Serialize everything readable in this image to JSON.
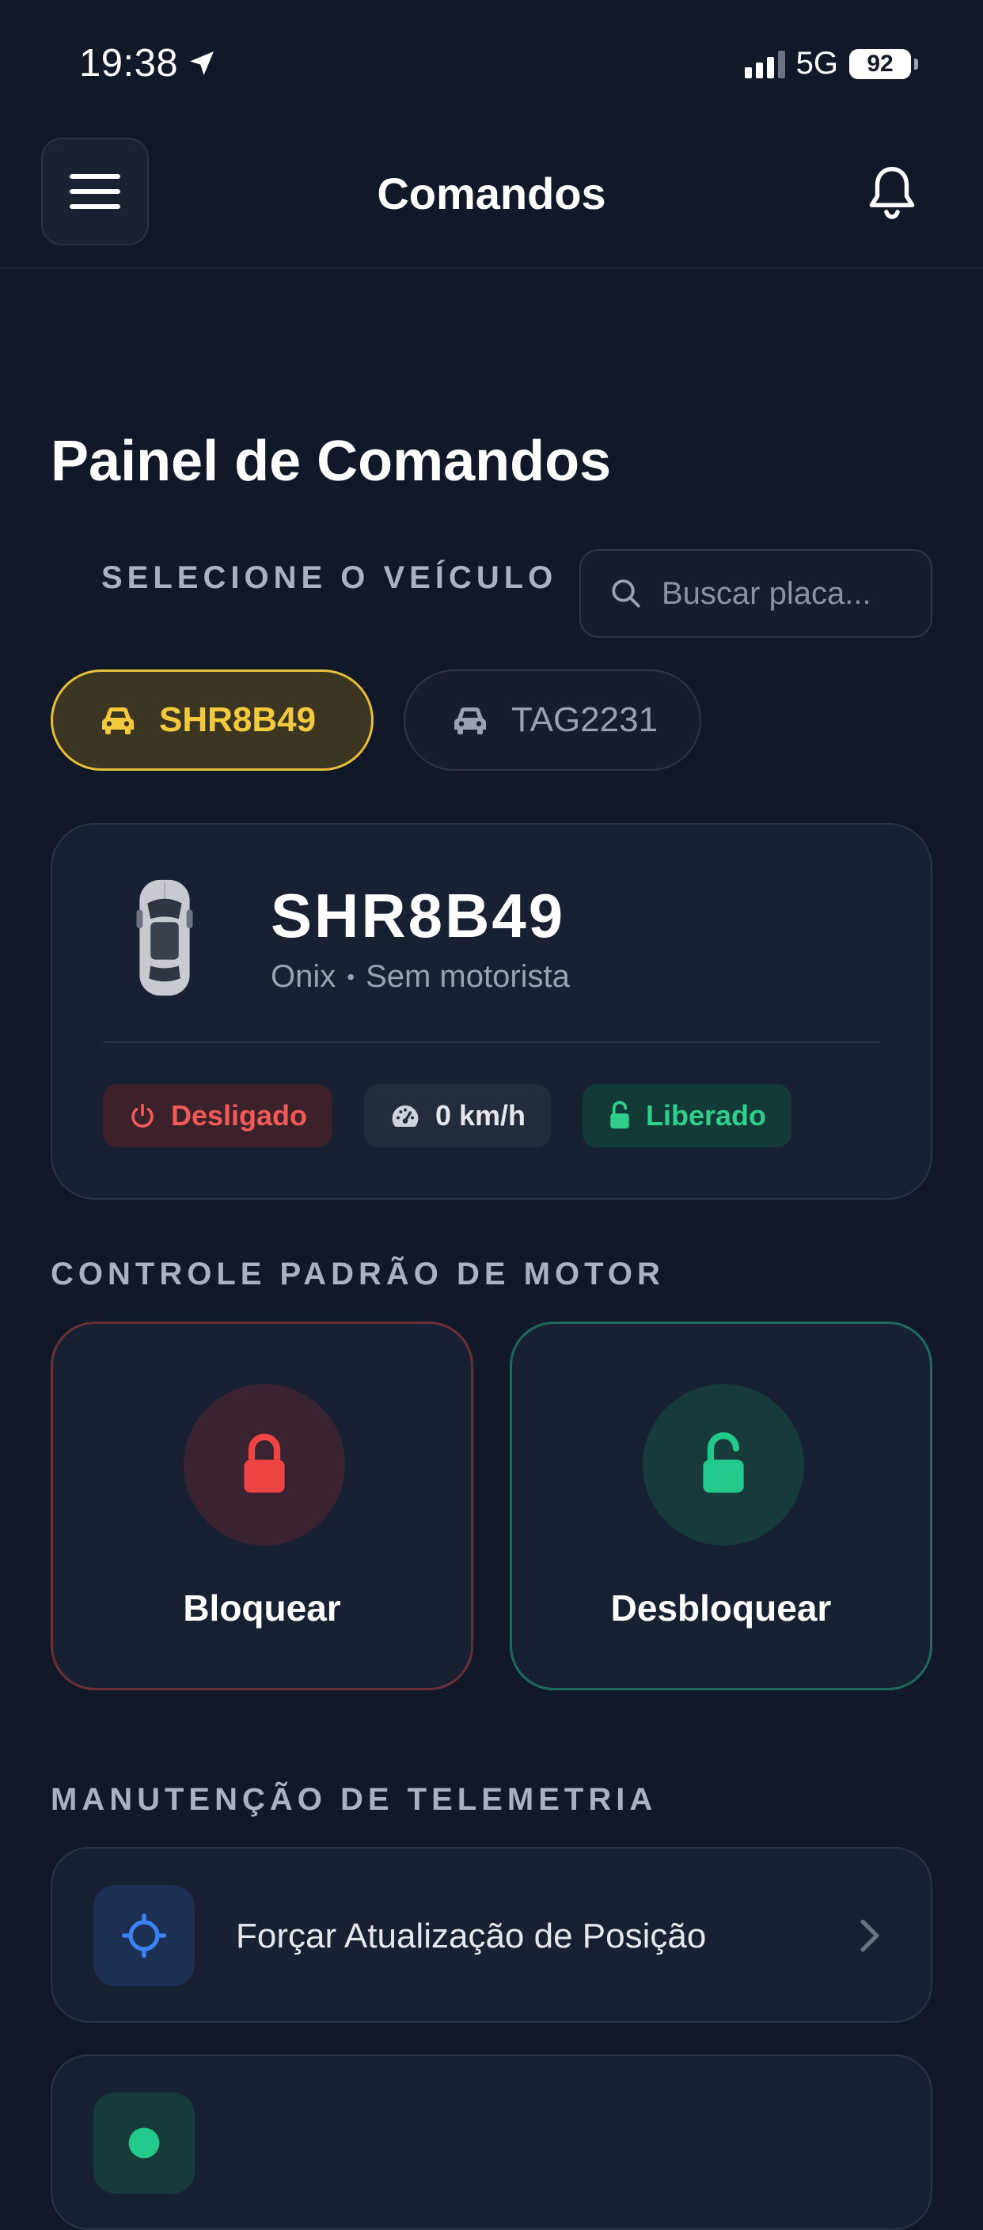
{
  "status_bar": {
    "time": "19:38",
    "network": "5G",
    "battery": "92"
  },
  "header": {
    "title": "Comandos"
  },
  "page": {
    "title": "Painel de Comandos",
    "select_label": "SELECIONE O VEÍCULO",
    "search_placeholder": "Buscar placa..."
  },
  "vehicle_chips": [
    {
      "plate": "SHR8B49",
      "selected": true
    },
    {
      "plate": "TAG2231",
      "selected": false
    }
  ],
  "vehicle_card": {
    "plate": "SHR8B49",
    "model": "Onix",
    "separator": "•",
    "driver": "Sem motorista",
    "badges": {
      "engine": "Desligado",
      "speed": "0 km/h",
      "lock": "Liberado"
    }
  },
  "motor_control": {
    "section_label": "CONTROLE PADRÃO DE MOTOR",
    "lock_label": "Bloquear",
    "unlock_label": "Desbloquear"
  },
  "telemetry": {
    "section_label": "MANUTENÇÃO DE TELEMETRIA",
    "items": [
      {
        "label": "Forçar Atualização de Posição",
        "icon": "crosshair-icon"
      },
      {
        "label": "",
        "icon": "circle-icon"
      }
    ]
  },
  "colors": {
    "background": "#111827",
    "accent_yellow": "#e8bf3a",
    "danger_red": "#f25a5a",
    "success_green": "#2fce8a",
    "info_blue": "#3b82f6"
  }
}
